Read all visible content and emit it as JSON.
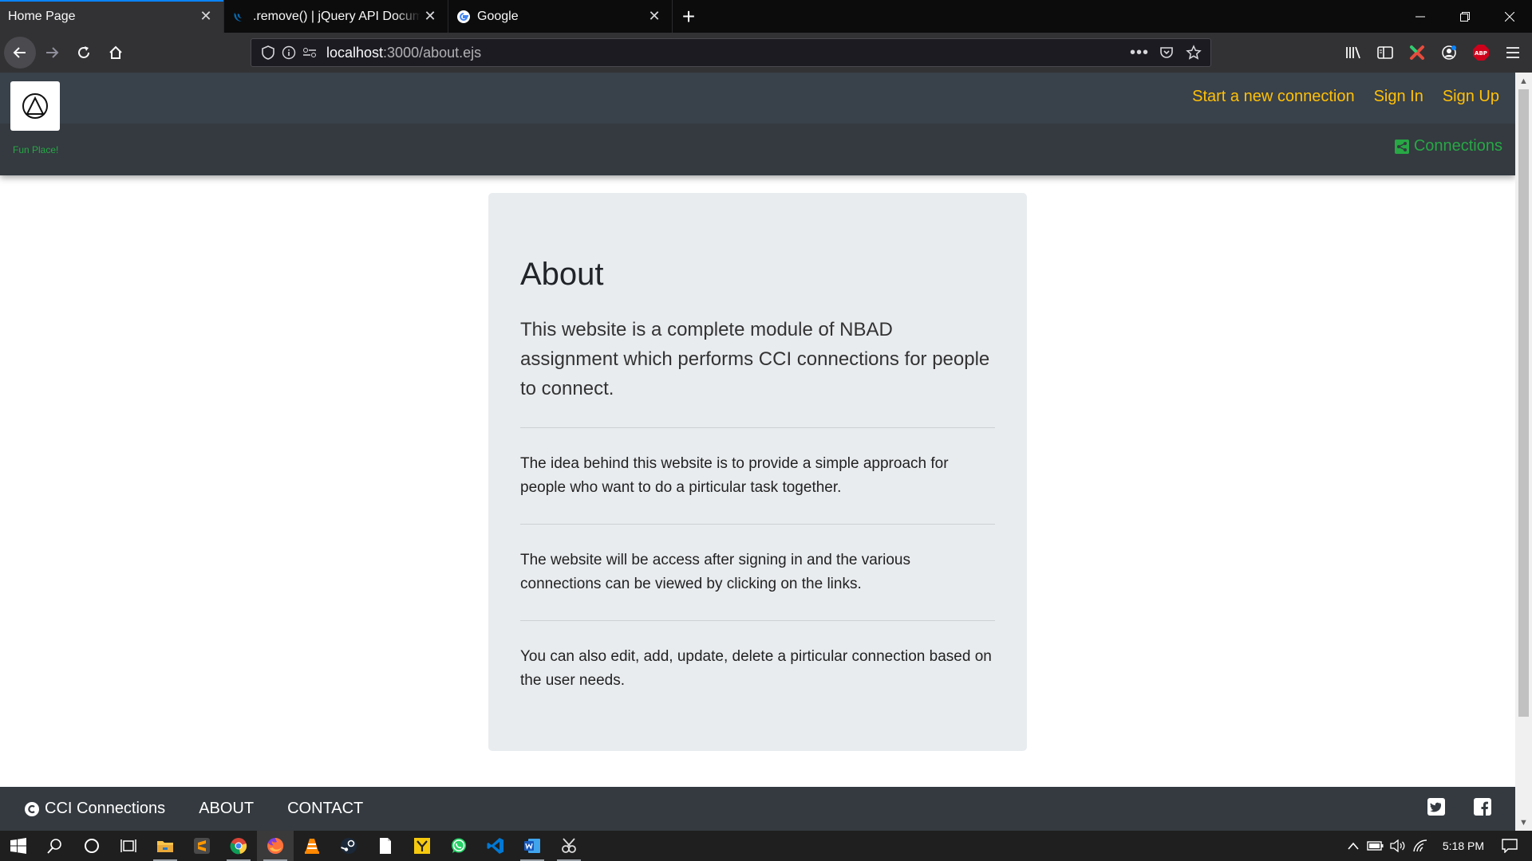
{
  "browser": {
    "tabs": [
      {
        "title": "Home Page",
        "active": true
      },
      {
        "title": ".remove() | jQuery API Documentation",
        "active": false
      },
      {
        "title": "Google",
        "active": false
      }
    ],
    "url": {
      "host": "localhost",
      "path": ":3000/about.ejs"
    }
  },
  "site": {
    "tagline": "Fun Place!",
    "nav": {
      "new_connection": "Start a new connection",
      "sign_in": "Sign In",
      "sign_up": "Sign Up",
      "connections": "Connections"
    },
    "about": {
      "title": "About",
      "lead": "This website is a complete module of NBAD assignment which performs CCI connections for people to connect.",
      "p1": "The idea behind this website is to provide a simple approach for people who want to do a pirticular task together.",
      "p2": "The website will be access after signing in and the various connections can be viewed by clicking on the links.",
      "p3": "You can also edit, add, update, delete a pirticular connection based on the user needs."
    },
    "footer": {
      "brand": "CCI Connections",
      "about": "ABOUT",
      "contact": "CONTACT"
    },
    "colors": {
      "accent_link": "#ffc107",
      "green": "#28a745",
      "header_bg": "#343a40"
    }
  },
  "taskbar": {
    "clock": "5:18 PM",
    "abp": "ABP"
  }
}
